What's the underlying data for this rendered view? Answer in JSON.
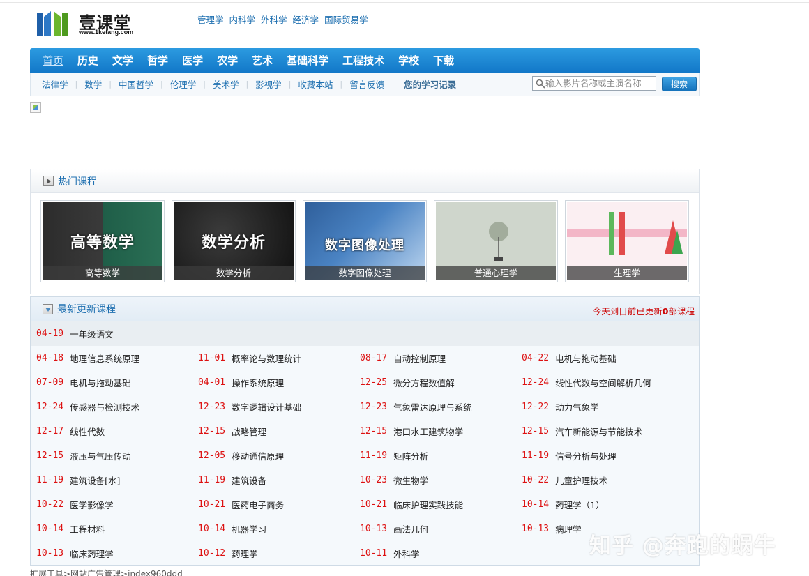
{
  "logo": {
    "name": "壹课堂",
    "url": "www.1ketang.com"
  },
  "top_links": [
    "管理学",
    "内科学",
    "外科学",
    "经济学",
    "国际贸易学"
  ],
  "main_nav": [
    "首页",
    "历史",
    "文学",
    "哲学",
    "医学",
    "农学",
    "艺术",
    "基础科学",
    "工程技术",
    "学校",
    "下载"
  ],
  "sub_nav": [
    "法律学",
    "数学",
    "中国哲学",
    "伦理学",
    "美术学",
    "影视学",
    "收藏本站",
    "留言反馈"
  ],
  "study_record": "您的学习记录",
  "search": {
    "placeholder": "输入影片名称或主演名称",
    "button": "搜索"
  },
  "hot_section": {
    "title": "热门课程",
    "items": [
      {
        "caption": "高等数学",
        "banner": "高等数学"
      },
      {
        "caption": "数学分析",
        "banner": "数学分析"
      },
      {
        "caption": "数字图像处理",
        "banner": "数字图像处理"
      },
      {
        "caption": "普通心理学",
        "banner": ""
      },
      {
        "caption": "生理学",
        "banner": ""
      }
    ]
  },
  "latest_section": {
    "title": "最新更新课程",
    "count_prefix": "今天到目前已更新",
    "count": "0",
    "count_suffix": "部课程",
    "first": {
      "date": "04-19",
      "title": "一年级语文"
    },
    "rows": [
      [
        {
          "date": "04-18",
          "title": "地理信息系统原理"
        },
        {
          "date": "11-01",
          "title": "概率论与数理统计"
        },
        {
          "date": "08-17",
          "title": "自动控制原理"
        },
        {
          "date": "04-22",
          "title": "电机与拖动基础"
        }
      ],
      [
        {
          "date": "07-09",
          "title": "电机与拖动基础"
        },
        {
          "date": "04-01",
          "title": "操作系统原理"
        },
        {
          "date": "12-25",
          "title": "微分方程数值解"
        },
        {
          "date": "12-24",
          "title": "线性代数与空间解析几何"
        }
      ],
      [
        {
          "date": "12-24",
          "title": "传感器与检测技术"
        },
        {
          "date": "12-23",
          "title": "数字逻辑设计基础"
        },
        {
          "date": "12-23",
          "title": "气象雷达原理与系统"
        },
        {
          "date": "12-22",
          "title": "动力气象学"
        }
      ],
      [
        {
          "date": "12-17",
          "title": "线性代数"
        },
        {
          "date": "12-15",
          "title": "战略管理"
        },
        {
          "date": "12-15",
          "title": "港口水工建筑物学"
        },
        {
          "date": "12-15",
          "title": "汽车新能源与节能技术"
        }
      ],
      [
        {
          "date": "12-15",
          "title": "液压与气压传动"
        },
        {
          "date": "12-05",
          "title": "移动通信原理"
        },
        {
          "date": "11-19",
          "title": "矩阵分析"
        },
        {
          "date": "11-19",
          "title": "信号分析与处理"
        }
      ],
      [
        {
          "date": "11-19",
          "title": "建筑设备[水]"
        },
        {
          "date": "11-19",
          "title": "建筑设备"
        },
        {
          "date": "10-23",
          "title": "微生物学"
        },
        {
          "date": "10-22",
          "title": "儿童护理技术"
        }
      ],
      [
        {
          "date": "10-22",
          "title": "医学影像学"
        },
        {
          "date": "10-21",
          "title": "医药电子商务"
        },
        {
          "date": "10-21",
          "title": "临床护理实践技能"
        },
        {
          "date": "10-14",
          "title": "药理学（1）"
        }
      ],
      [
        {
          "date": "10-14",
          "title": "工程材料"
        },
        {
          "date": "10-14",
          "title": "机器学习"
        },
        {
          "date": "10-13",
          "title": "画法几何"
        },
        {
          "date": "10-13",
          "title": "病理学"
        }
      ],
      [
        {
          "date": "10-13",
          "title": "临床药理学"
        },
        {
          "date": "10-12",
          "title": "药理学"
        },
        {
          "date": "10-11",
          "title": "外科学"
        }
      ]
    ]
  },
  "footer_path": "扩展工具>网站广告管理>index960ddd",
  "watermark": "知乎 @奔跑的蜗牛",
  "colors": {
    "nav_blue": "#1a86d4",
    "link_blue": "#1d6fb0",
    "date_red": "#dd1111"
  }
}
